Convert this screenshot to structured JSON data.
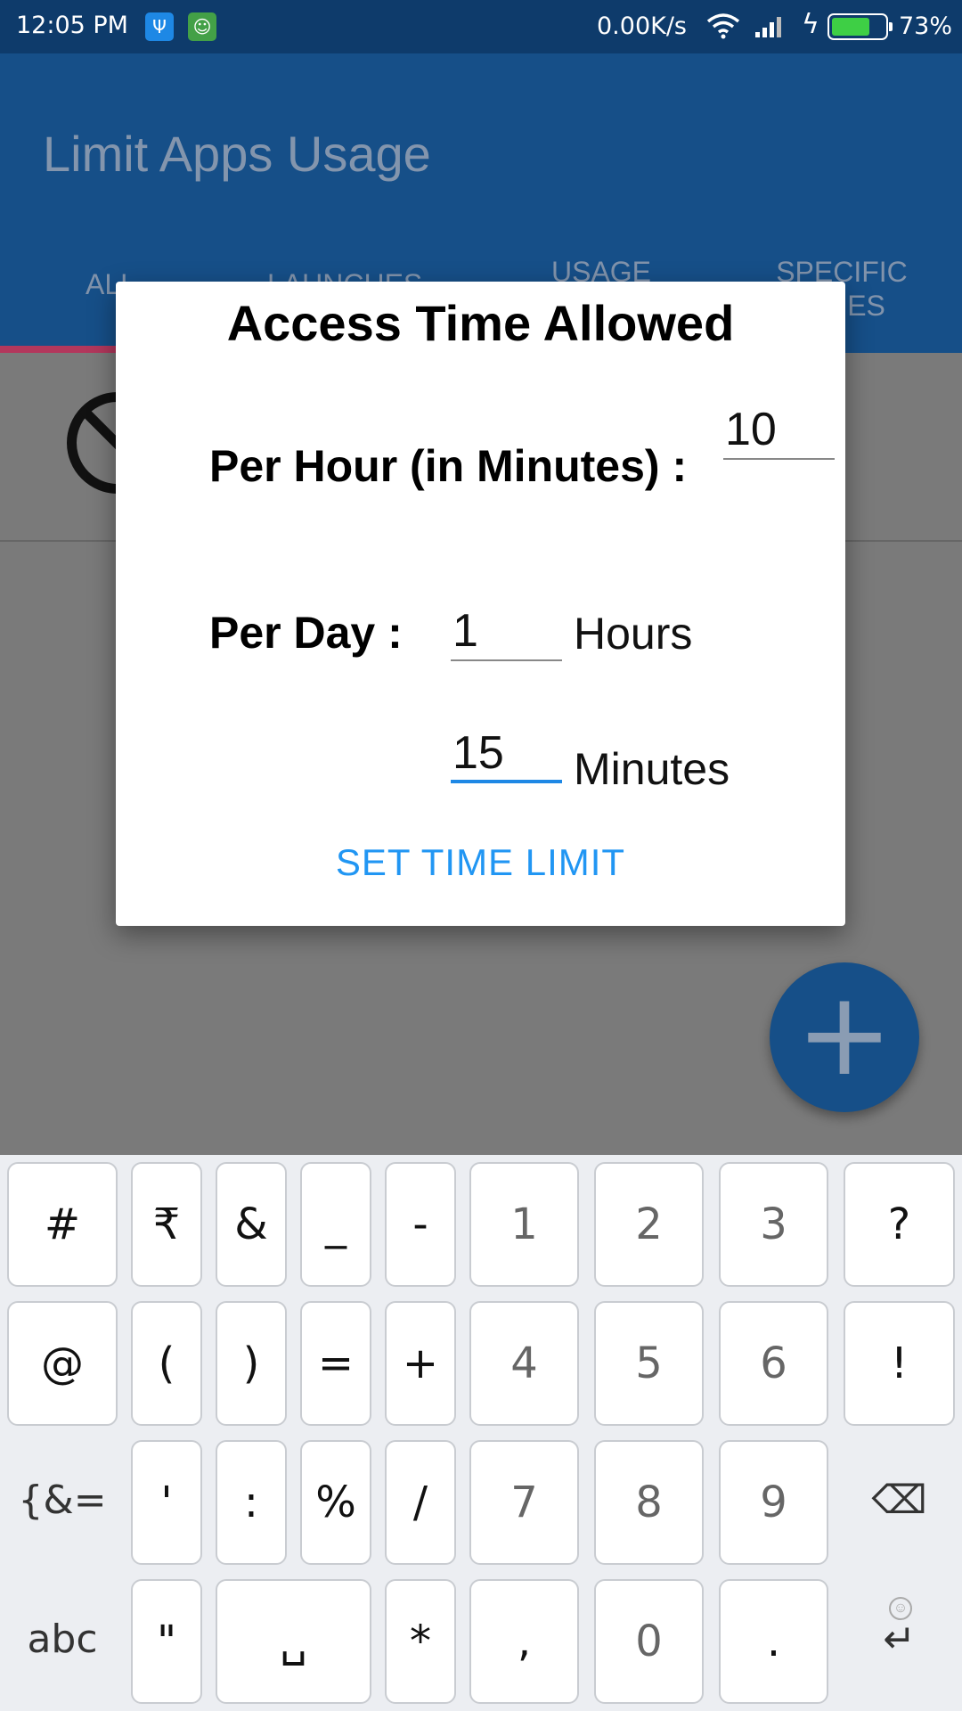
{
  "status_bar": {
    "time": "12:05 PM",
    "net_speed": "0.00K/s",
    "battery_pct": "73%",
    "battery_level": 0.73,
    "icons": [
      "usb-icon",
      "android-debug-icon",
      "wifi-icon",
      "signal-icon",
      "charging-icon",
      "battery-icon"
    ]
  },
  "app_bar": {
    "title": "Limit Apps Usage",
    "tabs": [
      {
        "label": "ALL"
      },
      {
        "label": "LAUNCHES"
      },
      {
        "label": "USAGE\nTIME"
      },
      {
        "label": "SPECIFIC\nTIMES"
      }
    ]
  },
  "dialog": {
    "title": "Access Time Allowed",
    "per_hour_label": "Per Hour (in Minutes) :",
    "per_hour_value": "10",
    "per_day_label": "Per Day :",
    "per_day_hours_value": "1",
    "hours_unit": "Hours",
    "per_day_minutes_value": "15",
    "minutes_unit": "Minutes",
    "button": "SET TIME LIMIT"
  },
  "background": {
    "exclaim": "!",
    "fab_symbol": "+"
  },
  "keyboard": {
    "row1": [
      "#",
      "₹",
      "&",
      "_",
      "-",
      "1",
      "2",
      "3",
      "?"
    ],
    "row2": [
      "@",
      "(",
      ")",
      "=",
      "+",
      "4",
      "5",
      "6",
      "!"
    ],
    "row3": [
      "{&=",
      "'",
      ":",
      "%",
      "/",
      "7",
      "8",
      "9",
      "⌫"
    ],
    "row4": [
      "abc",
      "\"",
      "␣",
      "*",
      ",",
      "0",
      ".",
      "↵"
    ]
  },
  "colors": {
    "status_bar": "#0e3b6b",
    "app_bar": "#164f88",
    "tab_indicator": "#b2375c",
    "accent": "#2196f3",
    "battery_green": "#3ecf45"
  }
}
